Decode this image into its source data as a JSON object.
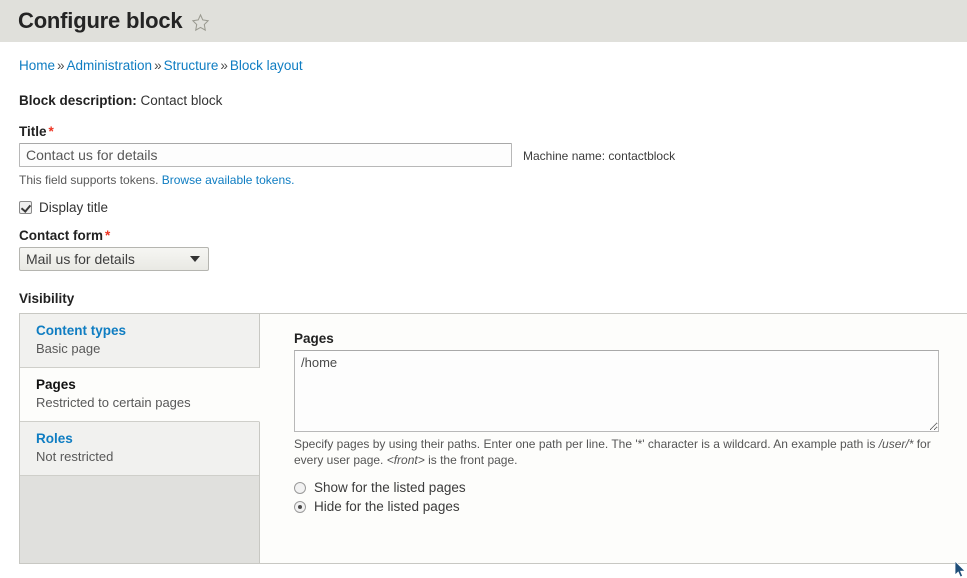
{
  "header": {
    "title": "Configure block",
    "star_icon": "star-outline-icon"
  },
  "breadcrumb": {
    "separator": "»",
    "items": [
      {
        "label": "Home"
      },
      {
        "label": "Administration"
      },
      {
        "label": "Structure"
      },
      {
        "label": "Block layout"
      }
    ]
  },
  "block_description": {
    "label": "Block description:",
    "value": "Contact block"
  },
  "title_field": {
    "label": "Title",
    "required_marker": "*",
    "value": "Contact us for details",
    "placeholder": "Contact us for details",
    "machine_name_label": "Machine name:",
    "machine_name_value": "contactblock",
    "description_text": "This field supports tokens.",
    "description_link": "Browse available tokens."
  },
  "display_title": {
    "label": "Display title",
    "checked": true
  },
  "contact_form": {
    "label": "Contact form",
    "required_marker": "*",
    "selected": "Mail us for details",
    "options": [
      "Mail us for details"
    ],
    "arrow_icon": "chevron-down-icon"
  },
  "visibility": {
    "heading": "Visibility",
    "tabs": [
      {
        "title": "Content types",
        "summary": "Basic page",
        "active": false
      },
      {
        "title": "Pages",
        "summary": "Restricted to certain pages",
        "active": true
      },
      {
        "title": "Roles",
        "summary": "Not restricted",
        "active": false
      }
    ],
    "pages_pane": {
      "label": "Pages",
      "textarea_value": "/home",
      "description_parts": {
        "p1": "Specify pages by using their paths. Enter one path per line. The '*' character is a wildcard. An example path is ",
        "em1": "/user/*",
        "p2": " for every user page. ",
        "em2": "<front>",
        "p3": " is the front page."
      },
      "radios": [
        {
          "label": "Show for the listed pages",
          "selected": false
        },
        {
          "label": "Hide for the listed pages",
          "selected": true
        }
      ]
    }
  },
  "colors": {
    "header_band": "#e0e0db",
    "link": "#0f7dc2",
    "required": "#ee3322",
    "panel_bg": "#fdfdfb",
    "tab_inactive": "#f1f1ef"
  }
}
